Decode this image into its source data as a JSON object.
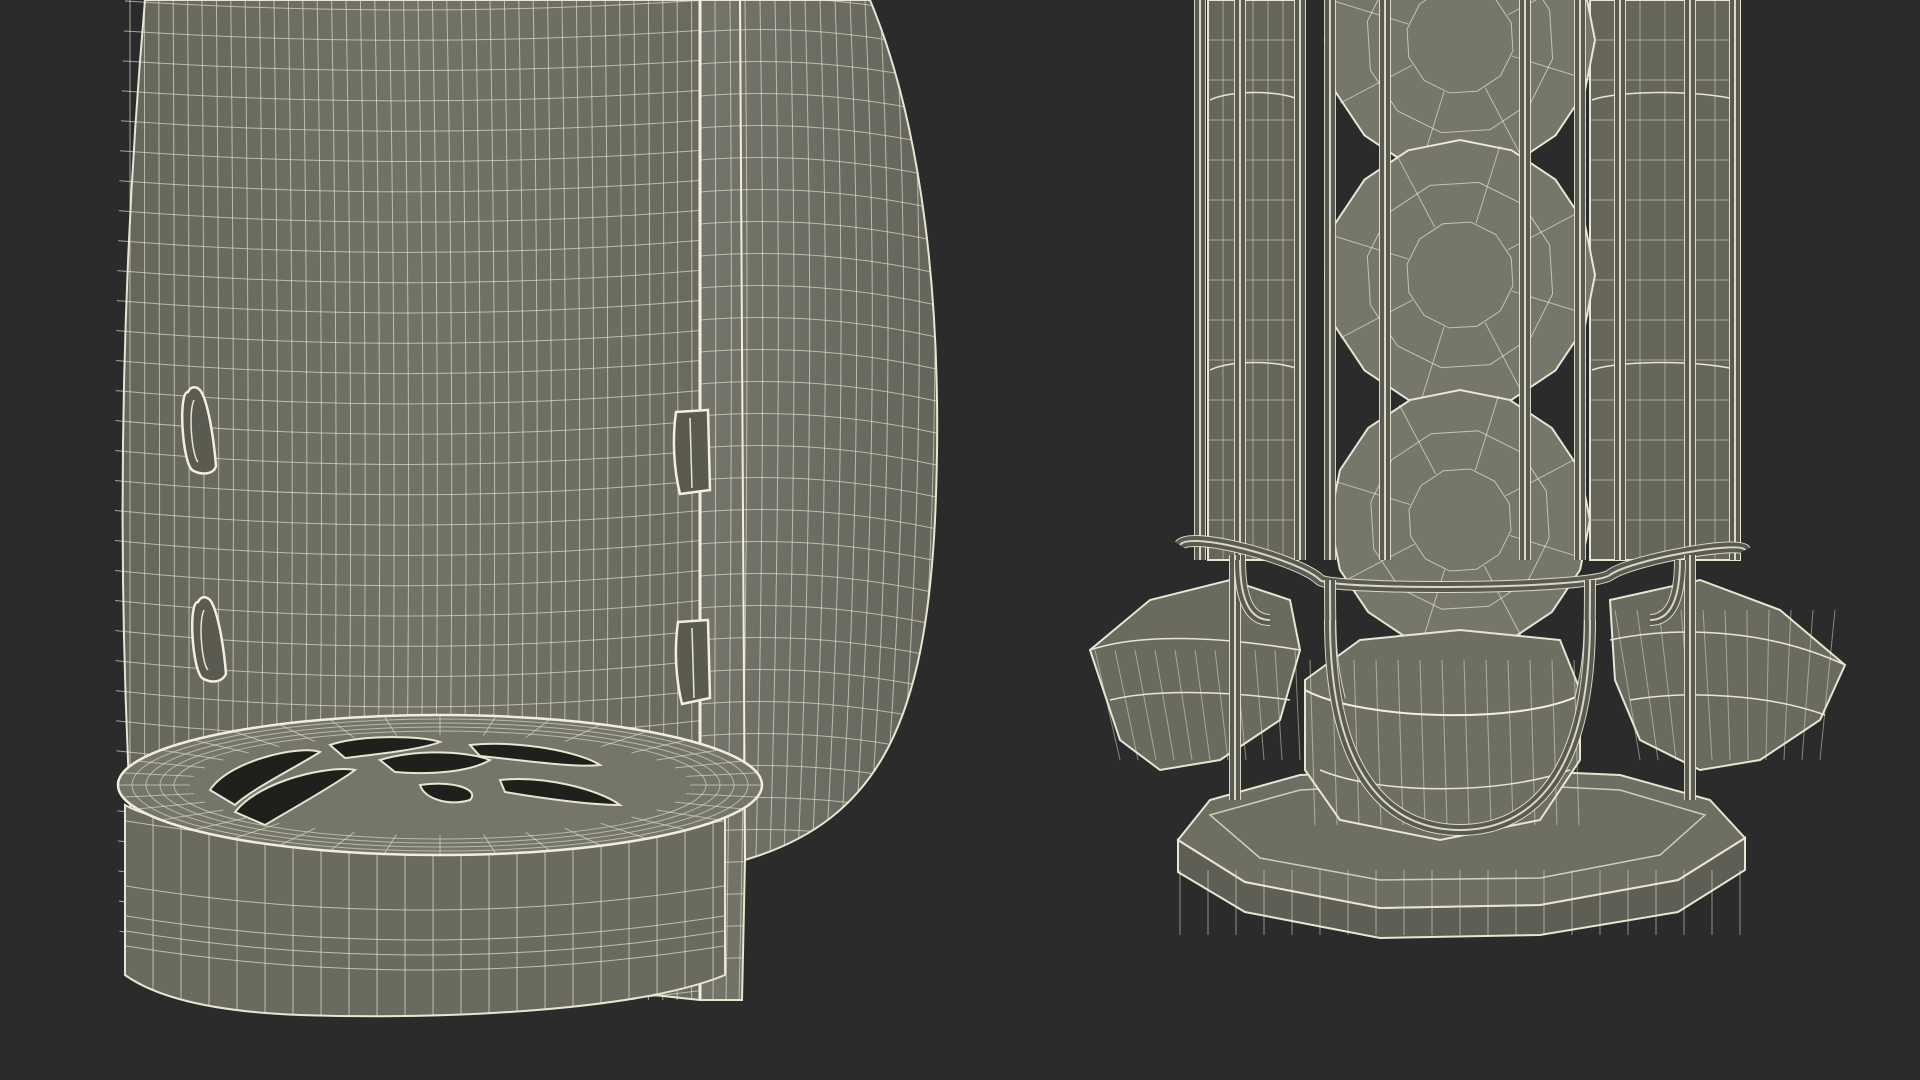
{
  "scene": {
    "background": "#2b2b2b",
    "surface_fill": "#6e6e63",
    "surface_shade": "#5c5c52",
    "surface_light": "#7d7d71",
    "wire_color": "#e6e6d2",
    "left_object": "coffee-machine-wireframe",
    "right_object": "capsule-rack-wireframe"
  }
}
